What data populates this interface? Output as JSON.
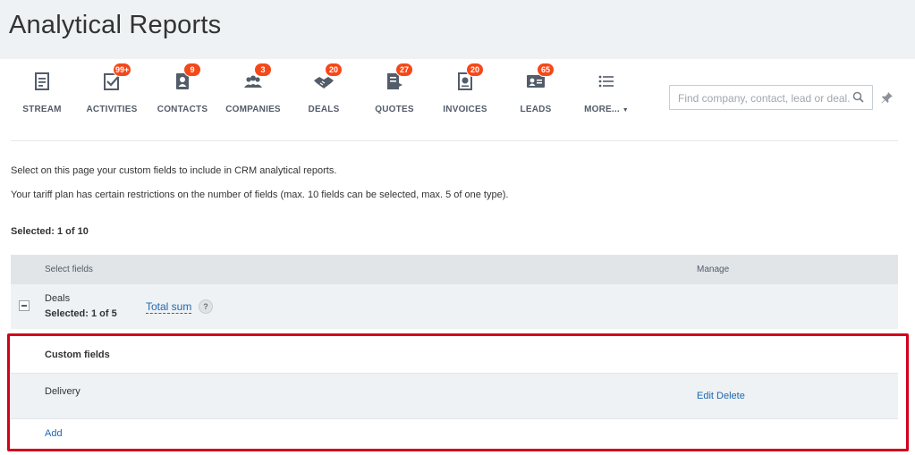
{
  "page": {
    "title": "Analytical Reports"
  },
  "toolbar": {
    "items": [
      {
        "label": "STREAM",
        "icon": "stream-icon",
        "badge": ""
      },
      {
        "label": "ACTIVITIES",
        "icon": "activities-icon",
        "badge": "99+"
      },
      {
        "label": "CONTACTS",
        "icon": "contacts-icon",
        "badge": "9"
      },
      {
        "label": "COMPANIES",
        "icon": "companies-icon",
        "badge": "3"
      },
      {
        "label": "DEALS",
        "icon": "deals-icon",
        "badge": "20"
      },
      {
        "label": "QUOTES",
        "icon": "quotes-icon",
        "badge": "27"
      },
      {
        "label": "INVOICES",
        "icon": "invoices-icon",
        "badge": "20"
      },
      {
        "label": "LEADS",
        "icon": "leads-icon",
        "badge": "65"
      },
      {
        "label": "MORE...",
        "icon": "more-list-icon",
        "badge": ""
      }
    ],
    "search_placeholder": "Find company, contact, lead or deal..."
  },
  "info": {
    "line1": "Select on this page your custom fields to include in CRM analytical reports.",
    "line2": "Your tariff plan has certain restrictions on the number of fields (max. 10 fields can be selected, max. 5 of one type).",
    "selected": "Selected: 1 of 10"
  },
  "table": {
    "col_select": "Select fields",
    "col_manage": "Manage",
    "group": {
      "name": "Deals",
      "selected": "Selected: 1 of 5",
      "field_link": "Total sum",
      "help": "?"
    },
    "custom_fields_title": "Custom fields",
    "custom_field": {
      "name": "Delivery",
      "edit": "Edit",
      "delete": "Delete"
    },
    "add_label": "Add"
  },
  "colors": {
    "badge": "#f54819",
    "link": "#2067b0",
    "highlight": "#d0021b",
    "header_bg": "#e1e5e8"
  }
}
